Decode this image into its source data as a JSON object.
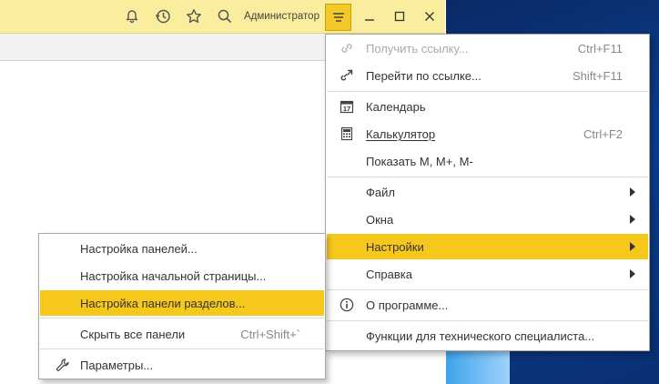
{
  "titlebar": {
    "user": "Администратор",
    "icons": [
      "bell-icon",
      "history-icon",
      "star-icon",
      "search-icon"
    ],
    "accent": "#f7c81c",
    "bar_color": "#fbed9e"
  },
  "main_menu": {
    "items": [
      {
        "label": "Получить ссылку...",
        "shortcut": "Ctrl+F11",
        "icon": "link-icon",
        "disabled": true
      },
      {
        "label": "Перейти по ссылке...",
        "shortcut": "Shift+F11",
        "icon": "go-link-icon"
      },
      {
        "label": "Календарь",
        "shortcut": "",
        "icon": "calendar-icon",
        "icon_text": "17"
      },
      {
        "label": "Калькулятор",
        "shortcut": "Ctrl+F2",
        "icon": "calculator-icon"
      },
      {
        "label": "Показать M, M+, M-",
        "shortcut": ""
      },
      {
        "label": "Файл",
        "submenu": true
      },
      {
        "label": "Окна",
        "submenu": true
      },
      {
        "label": "Настройки",
        "submenu": true,
        "active": true
      },
      {
        "label": "Справка",
        "submenu": true
      },
      {
        "label": "О программе...",
        "icon": "info-icon"
      },
      {
        "label": "Функции для технического специалиста..."
      }
    ]
  },
  "sub_menu": {
    "items": [
      {
        "label": "Настройка панелей..."
      },
      {
        "label": "Настройка начальной страницы..."
      },
      {
        "label": "Настройка панели разделов...",
        "active": true
      },
      {
        "label": "Скрыть все панели",
        "shortcut": "Ctrl+Shift+`"
      },
      {
        "label": "Параметры...",
        "icon": "wrench-icon"
      }
    ]
  }
}
